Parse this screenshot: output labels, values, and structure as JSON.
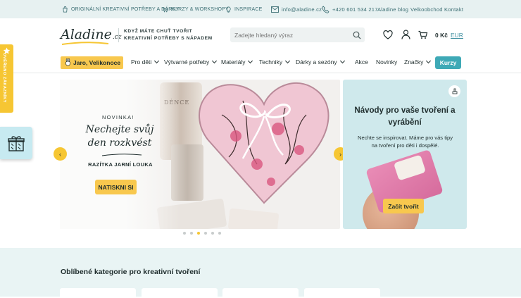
{
  "topbar": {
    "items": [
      {
        "label": "ORIGINÁLNÍ KREATIVNÍ POTŘEBY A DÁRKY",
        "icon": "bag-icon"
      },
      {
        "label": "KURZY & WORKSHOPY",
        "icon": "cart-icon"
      },
      {
        "label": "INSPIRACE",
        "icon": "lightbulb-icon"
      }
    ],
    "email": "info@aladine.cz",
    "phone": "+420 601 534 217",
    "links": [
      "Aladine blog",
      "Velkoobchod",
      "Kontakt"
    ]
  },
  "header": {
    "logo_text": "Aladine",
    "logo_suffix": ".cz",
    "tagline_line1": "KDYŽ MÁTE CHUŤ TVOŘIT",
    "tagline_line2": "KREATIVNÍ POTŘEBY S NÁPADEM",
    "search_placeholder": "Zadejte hledaný výraz",
    "cart_price": "0 Kč",
    "currency": "EUR"
  },
  "nav": {
    "season_label": "Jaro, Velikonoce",
    "items": [
      "Pro děti",
      "Výtvarné potřeby",
      "Materiály",
      "Techniky",
      "Dárky a sezóny",
      "Akce",
      "Novinky",
      "Značky"
    ],
    "cta_label": "Kurzy"
  },
  "side": {
    "badge_label": "OVĚŘENO ZÁKAZNÍKY"
  },
  "hero": {
    "eyebrow": "NOVINKA!",
    "title": "Nechejte svůj den rozkvést",
    "subtitle": "RAZÍTKA JARNÍ LOUKA",
    "button": "NATISKNI SI",
    "jar_label": "DÉNCE",
    "slides": 6,
    "active_slide": 3
  },
  "promo": {
    "title": "Návody pro vaše tvoření a vyrábění",
    "text": "Nechte se inspirovat. Máme pro vás tipy na tvoření pro děti i dospělé.",
    "button": "Začít tvořit"
  },
  "categories": {
    "title": "Oblíbené kategorie pro kreativní tvoření"
  },
  "colors": {
    "accent_yellow": "#f8c84e",
    "accent_teal": "#3ea9b6",
    "topbar_bg": "#e7f1f1",
    "band_bg": "#e9f4f4"
  }
}
